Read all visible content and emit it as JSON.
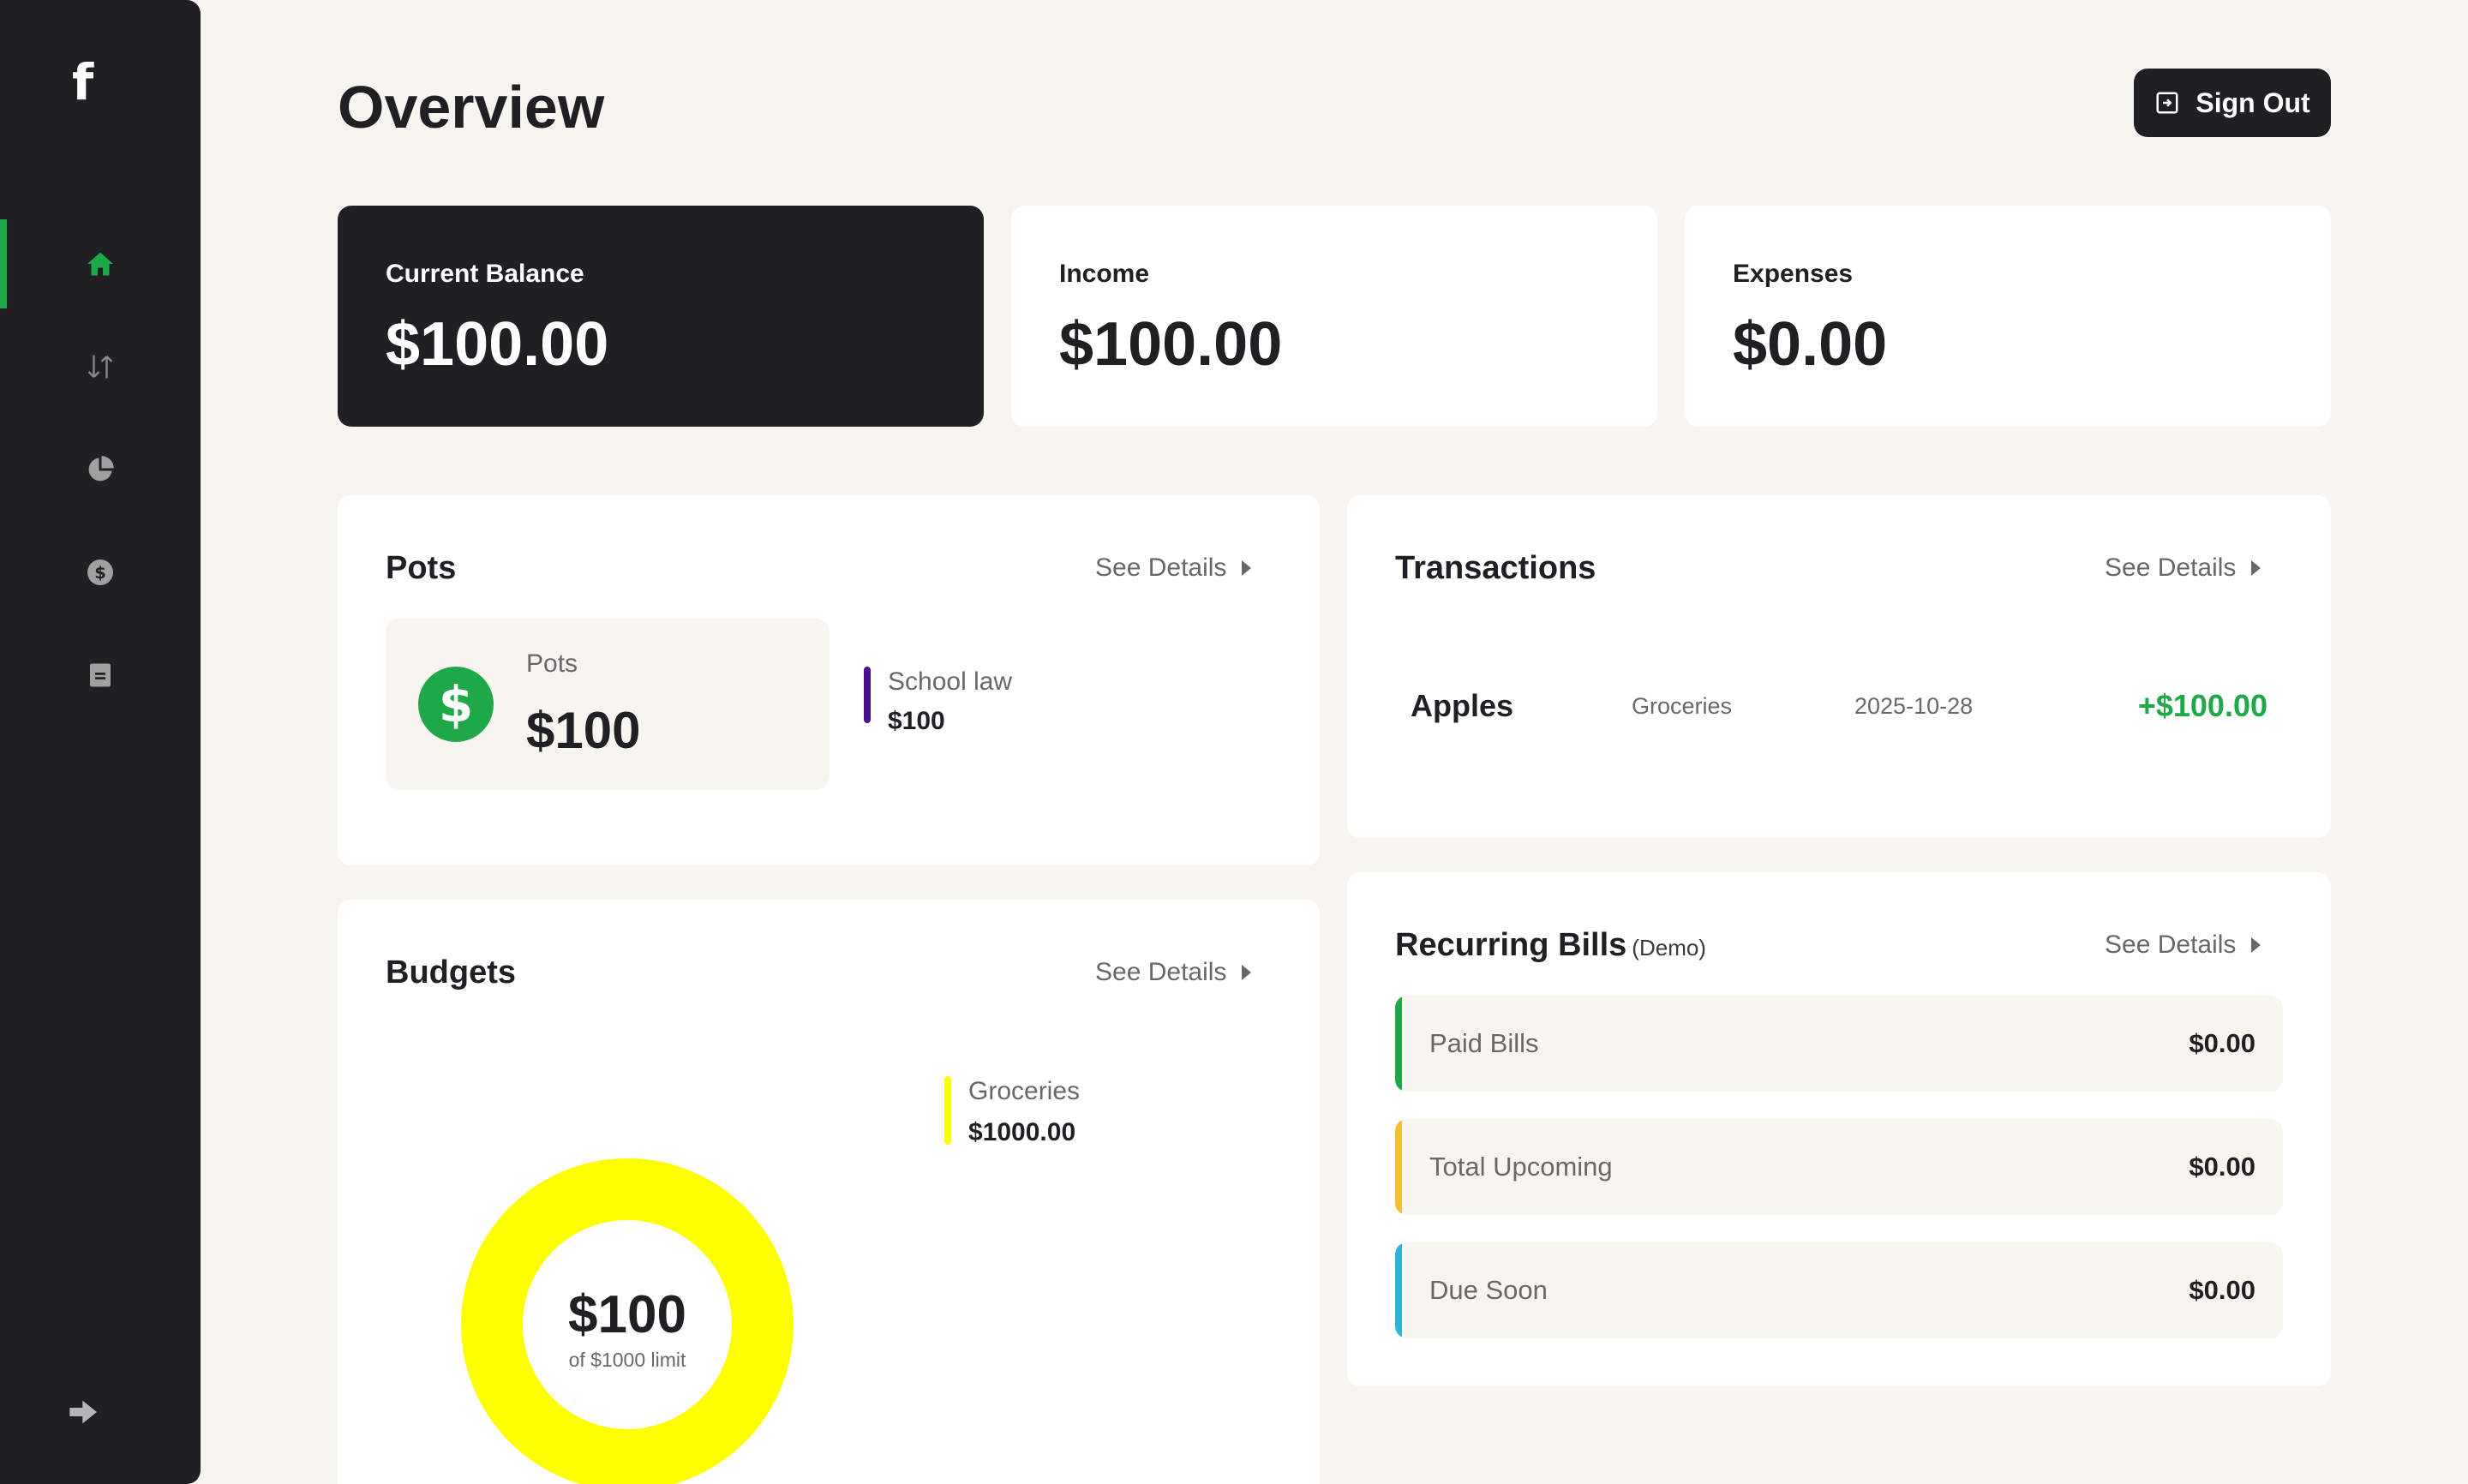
{
  "app": {
    "logo": "f"
  },
  "sidebar": {
    "items": [
      {
        "icon": "home-icon",
        "active": true
      },
      {
        "icon": "transactions-icon",
        "active": false
      },
      {
        "icon": "budgets-icon",
        "active": false
      },
      {
        "icon": "pots-icon",
        "active": false
      },
      {
        "icon": "recurring-bills-icon",
        "active": false
      }
    ],
    "minimize_icon": "arrow-right-icon"
  },
  "header": {
    "title": "Overview",
    "signout_label": "Sign Out"
  },
  "summary": {
    "balance": {
      "label": "Current Balance",
      "value": "$100.00"
    },
    "income": {
      "label": "Income",
      "value": "$100.00"
    },
    "expenses": {
      "label": "Expenses",
      "value": "$0.00"
    }
  },
  "pots": {
    "title": "Pots",
    "see_details": "See Details",
    "total_label": "Pots",
    "total_value": "$100",
    "items": [
      {
        "name": "School law",
        "value": "$100",
        "color": "#4b0f8f"
      }
    ]
  },
  "transactions": {
    "title": "Transactions",
    "see_details": "See Details",
    "rows": [
      {
        "name": "Apples",
        "category": "Groceries",
        "date": "2025-10-28",
        "amount": "+$100.00"
      }
    ]
  },
  "budgets": {
    "title": "Budgets",
    "see_details": "See Details",
    "spent": "$100",
    "limit_text": "of $1000 limit",
    "items": [
      {
        "name": "Groceries",
        "value": "$1000.00",
        "color": "#ffff00"
      }
    ]
  },
  "recurring": {
    "title": "Recurring Bills",
    "demo": "(Demo)",
    "see_details": "See Details",
    "bills": [
      {
        "name": "Paid Bills",
        "value": "$0.00",
        "color": "#1ea84a"
      },
      {
        "name": "Total Upcoming",
        "value": "$0.00",
        "color": "#f2c02e"
      },
      {
        "name": "Due Soon",
        "value": "$0.00",
        "color": "#2bb4d6"
      }
    ]
  },
  "colors": {
    "accent": "#1ea84a",
    "dark": "#201f24",
    "background": "#f8f4f0",
    "muted": "#696868"
  }
}
